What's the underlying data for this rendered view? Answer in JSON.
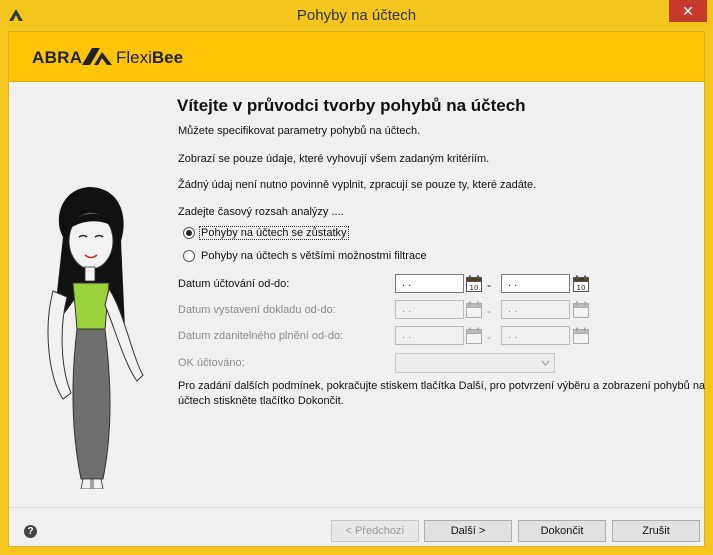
{
  "window": {
    "title": "Pohyby na účtech",
    "close_label": "✕"
  },
  "header": {
    "logo_abra": "ABRA",
    "logo_flexi": "Flexi",
    "logo_bee": "Bee"
  },
  "main": {
    "heading": "Vítejte v průvodci tvorby pohybů na účtech",
    "intro": "Můžete specifikovat parametry pohybů na účtech.",
    "filter_note": "Zobrazí se pouze údaje, které vyhovují všem zadaným kritériím.",
    "optional_note": "Žádný údaj není nutno povinně vyplnit, zpracují se pouze ty, které zadáte.",
    "range_prompt": "Zadejte časový rozsah analýzy ....",
    "radio_options": [
      {
        "label": "Pohyby na účtech se zůstatky",
        "checked": true
      },
      {
        "label": "Pohyby na účtech s většími možnostmi filtrace",
        "checked": false
      }
    ],
    "fields": [
      {
        "label": "Datum účtování od-do:",
        "from": " .  .",
        "to": " .  .",
        "enabled": true
      },
      {
        "label": "Datum vystavení dokladu od-do:",
        "from": " .  .",
        "to": " .  .",
        "enabled": false
      },
      {
        "label": "Datum zdanitelného plnění od-do:",
        "from": " .  .",
        "to": " .  .",
        "enabled": false
      }
    ],
    "dash": "-",
    "calendar_day": "10",
    "ok_label": "OK účtováno:",
    "ok_value": "",
    "instructions_line1": "Pro zadání dalších podmínek, pokračujte stiskem tlačítka Další, pro potvrzení výběru a zobrazení pohybů na",
    "instructions_line2": "účtech stiskněte tlačítko Dokončit."
  },
  "footer": {
    "help_label": "?",
    "prev_label": "< Předchozí",
    "next_label": "Další >",
    "finish_label": "Dokončit",
    "cancel_label": "Zrušit"
  },
  "colors": {
    "brand_yellow": "#fdc506",
    "close_red": "#c7392b",
    "dress_green": "#9bd13a"
  }
}
